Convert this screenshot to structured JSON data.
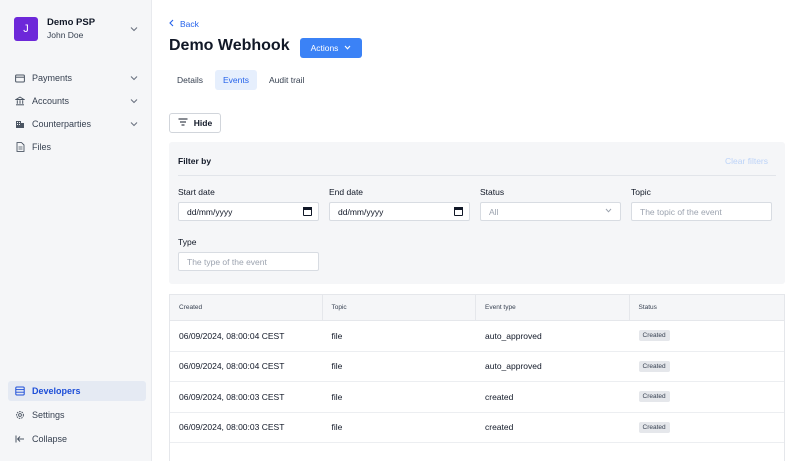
{
  "sidebar": {
    "org_name": "Demo PSP",
    "user_name": "John Doe",
    "avatar_letter": "J",
    "items": [
      {
        "label": "Payments",
        "icon": "card-icon"
      },
      {
        "label": "Accounts",
        "icon": "bank-icon"
      },
      {
        "label": "Counterparties",
        "icon": "building-icon"
      },
      {
        "label": "Files",
        "icon": "file-icon"
      }
    ],
    "bottom": [
      {
        "label": "Developers",
        "icon": "code-icon",
        "active": true
      },
      {
        "label": "Settings",
        "icon": "gear-icon"
      },
      {
        "label": "Collapse",
        "icon": "collapse-icon"
      }
    ]
  },
  "header": {
    "back_label": "Back",
    "title": "Demo Webhook",
    "actions_label": "Actions"
  },
  "tabs": [
    {
      "label": "Details",
      "active": false
    },
    {
      "label": "Events",
      "active": true
    },
    {
      "label": "Audit trail",
      "active": false
    }
  ],
  "hide_label": "Hide",
  "filters": {
    "title": "Filter by",
    "clear_label": "Clear filters",
    "start_date_label": "Start date",
    "start_date_value": "dd/mm/yyyy",
    "end_date_label": "End date",
    "end_date_value": "dd/mm/yyyy",
    "status_label": "Status",
    "status_value": "All",
    "topic_label": "Topic",
    "topic_placeholder": "The topic of the event",
    "type_label": "Type",
    "type_placeholder": "The type of the event"
  },
  "table": {
    "columns": [
      "Created",
      "Topic",
      "Event type",
      "Status"
    ],
    "rows": [
      {
        "created": "06/09/2024, 08:00:04 CEST",
        "topic": "file",
        "event_type": "auto_approved",
        "status": "Created"
      },
      {
        "created": "06/09/2024, 08:00:04 CEST",
        "topic": "file",
        "event_type": "auto_approved",
        "status": "Created"
      },
      {
        "created": "06/09/2024, 08:00:03 CEST",
        "topic": "file",
        "event_type": "created",
        "status": "Created"
      },
      {
        "created": "06/09/2024, 08:00:03 CEST",
        "topic": "file",
        "event_type": "created",
        "status": "Created"
      }
    ]
  },
  "colors": {
    "accent": "#3b82f6",
    "avatar": "#6d28d9",
    "active_nav_bg": "#e5eaf3"
  }
}
